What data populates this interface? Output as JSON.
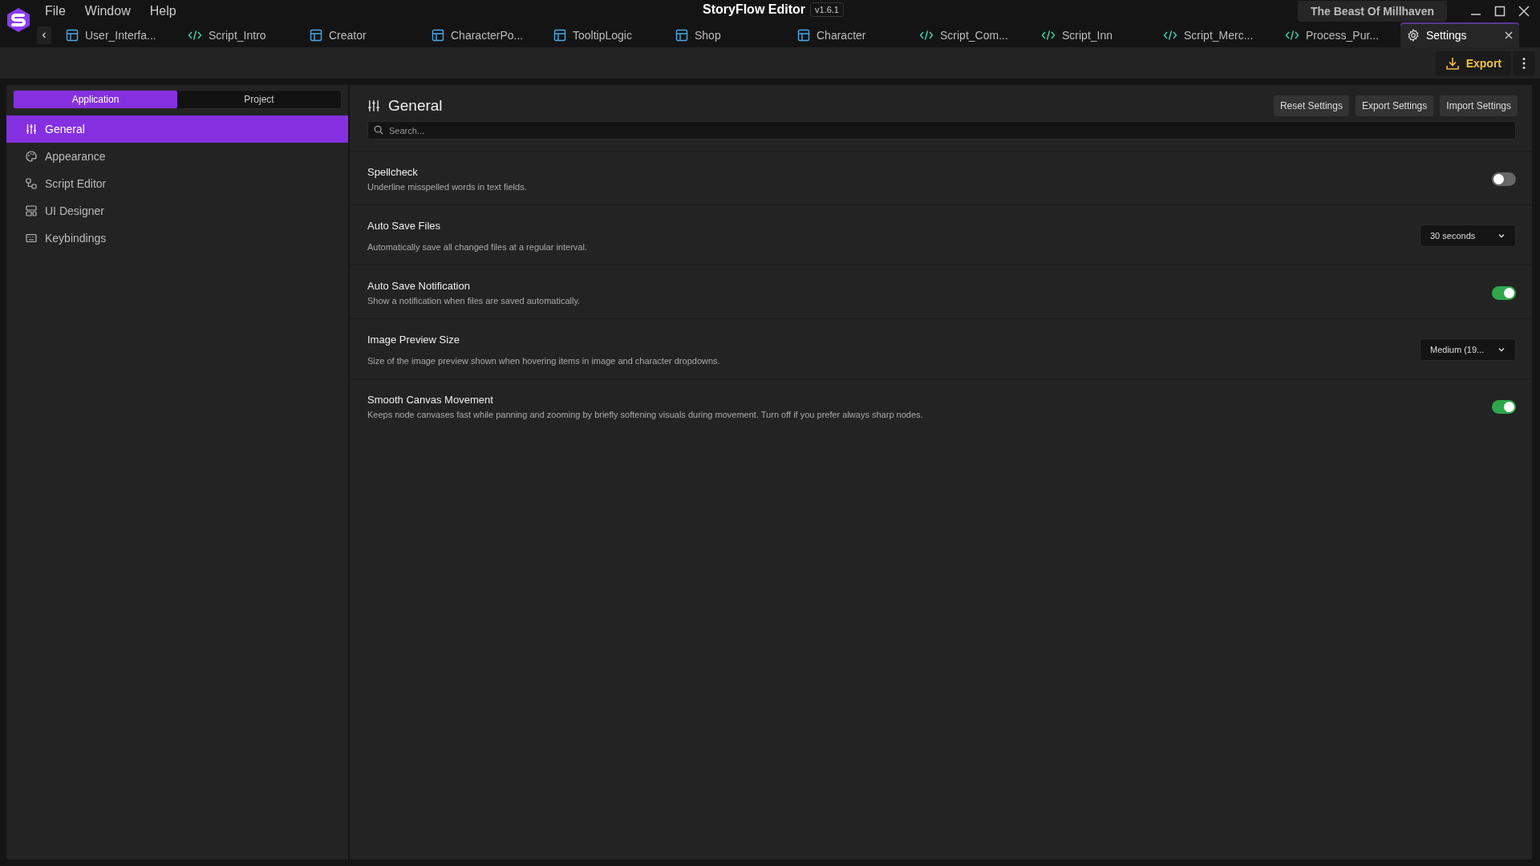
{
  "menu": [
    "File",
    "Window",
    "Help"
  ],
  "window": {
    "title": "StoryFlow Editor",
    "version": "v1.6.1",
    "project": "The Beast Of Millhaven"
  },
  "tabs": [
    {
      "label": "User_Interfa...",
      "kind": "layout",
      "selected": false
    },
    {
      "label": "Script_Intro",
      "kind": "script",
      "selected": false
    },
    {
      "label": "Creator",
      "kind": "layout",
      "selected": false
    },
    {
      "label": "CharacterPo...",
      "kind": "layout",
      "selected": false
    },
    {
      "label": "TooltipLogic",
      "kind": "layout",
      "selected": false
    },
    {
      "label": "Shop",
      "kind": "layout",
      "selected": false
    },
    {
      "label": "Character",
      "kind": "layout",
      "selected": false
    },
    {
      "label": "Script_Com...",
      "kind": "script",
      "selected": false
    },
    {
      "label": "Script_Inn",
      "kind": "script",
      "selected": false
    },
    {
      "label": "Script_Merc...",
      "kind": "script",
      "selected": false
    },
    {
      "label": "Process_Pur...",
      "kind": "script",
      "selected": false
    },
    {
      "label": "Settings",
      "kind": "settings",
      "selected": true
    }
  ],
  "toolbar": {
    "export": "Export"
  },
  "scope_tabs": [
    {
      "label": "Application",
      "selected": true
    },
    {
      "label": "Project",
      "selected": false
    }
  ],
  "sidebar": {
    "items": [
      {
        "label": "General",
        "kind": "sliders",
        "selected": true
      },
      {
        "label": "Appearance",
        "kind": "palette",
        "selected": false
      },
      {
        "label": "Script Editor",
        "kind": "nodes",
        "selected": false
      },
      {
        "label": "UI Designer",
        "kind": "layout",
        "selected": false
      },
      {
        "label": "Keybindings",
        "kind": "keyboard",
        "selected": false
      }
    ]
  },
  "panel": {
    "title": "General",
    "buttons": [
      "Reset Settings",
      "Export Settings",
      "Import Settings"
    ],
    "search": {
      "placeholder": "Search..."
    }
  },
  "settings": [
    {
      "title": "Spellcheck",
      "description": "Underline misspelled words in text fields.",
      "kind": "toggle",
      "on": false
    },
    {
      "title": "Auto Save Files",
      "description": "Automatically save all changed files at a regular interval.",
      "kind": "dropdown",
      "value": "30 seconds"
    },
    {
      "title": "Auto Save Notification",
      "description": "Show a notification when files are saved automatically.",
      "kind": "toggle",
      "on": true
    },
    {
      "title": "Image Preview Size",
      "description": "Size of the image preview shown when hovering items in image and character dropdowns.",
      "kind": "dropdown",
      "value": "Medium (19..."
    },
    {
      "title": "Smooth Canvas Movement",
      "description": "Keeps node canvases fast while panning and zooming by briefly softening visuals during movement. Turn off if you prefer always sharp nodes.",
      "kind": "toggle",
      "on": true
    }
  ]
}
